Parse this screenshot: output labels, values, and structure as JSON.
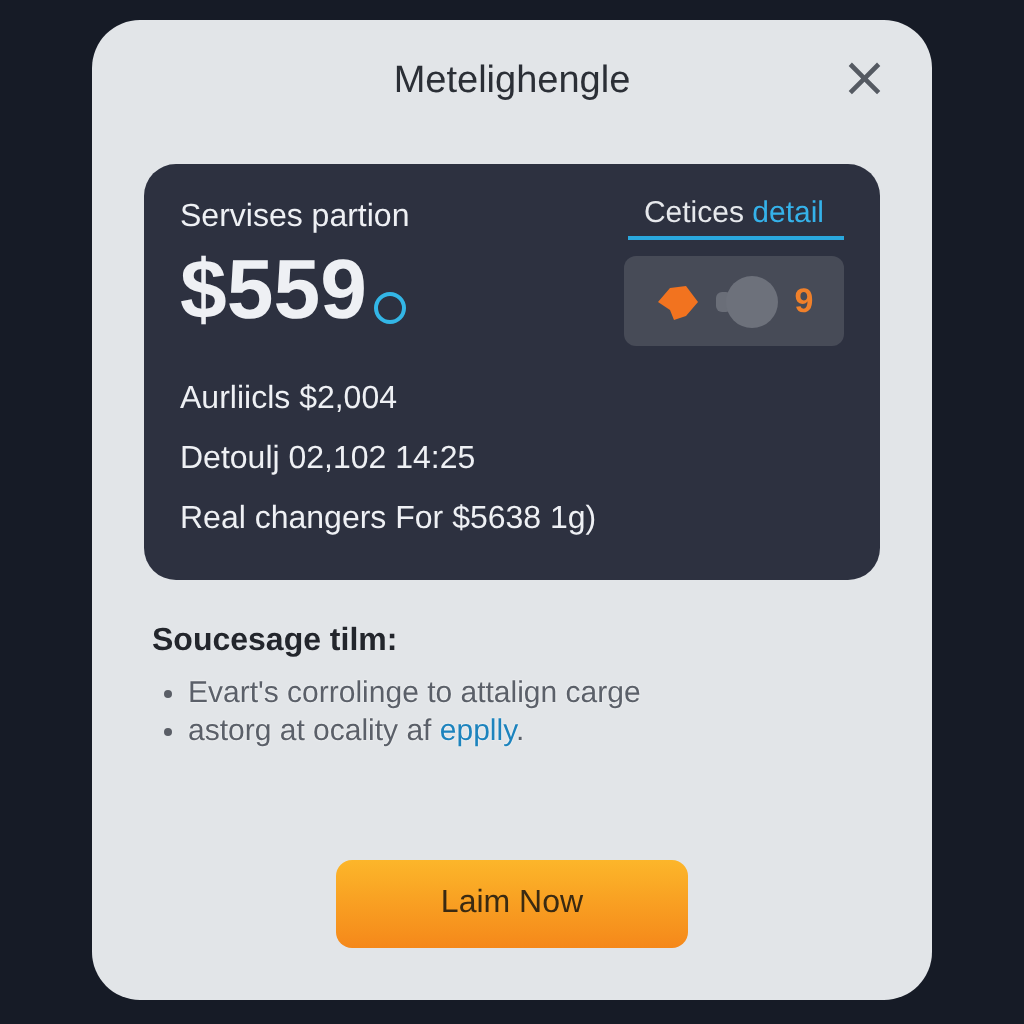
{
  "dialog": {
    "title": "Metelighengle",
    "close": "×"
  },
  "card": {
    "label": "Servises partion",
    "amount": "$559",
    "tab": {
      "label": "Cetices",
      "accent": "detail"
    },
    "widget_value": "9",
    "lines": [
      "Aurliicls $2,004",
      "Detoulj 02,102 14:25",
      "Real changers For $5638 1g)"
    ]
  },
  "section": {
    "heading": "Soucesage tilm:",
    "bullets": [
      {
        "text": "Evart's corrolinge to attalign carge"
      },
      {
        "text": "astorg at ocality af ",
        "link": "epplly",
        "tail": "."
      }
    ]
  },
  "button": {
    "label": "Laim Now"
  }
}
